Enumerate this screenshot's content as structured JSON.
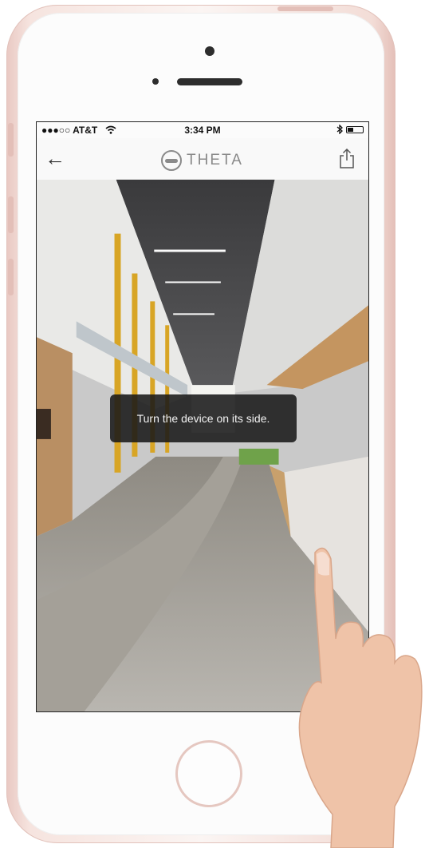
{
  "status_bar": {
    "carrier": "●●●○○ AT&T",
    "time": "3:34 PM"
  },
  "nav": {
    "logo_text": "THETA"
  },
  "toast": {
    "message": "Turn the device on its side."
  },
  "icons": [
    "wifi-icon",
    "bluetooth-icon",
    "battery-icon",
    "back-arrow-icon",
    "theta-logo-icon",
    "share-icon"
  ],
  "colors": {
    "phone_rose_gold": "#e9c9c3",
    "toast_bg": "#191919",
    "logo_gray": "#8a8a8a"
  }
}
